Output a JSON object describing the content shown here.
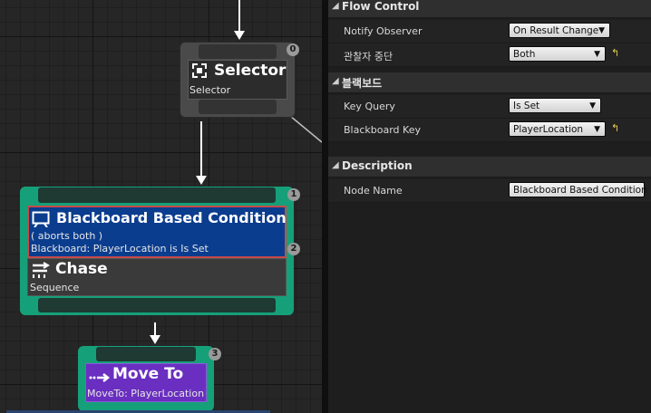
{
  "graph": {
    "selector_node": {
      "title": "Selector",
      "subtitle": "Selector",
      "index": "0",
      "icon": "selector-icon"
    },
    "chase_group": {
      "index": "1",
      "decorator": {
        "title": "Blackboard Based Condition",
        "line1": "( aborts both )",
        "line2": "Blackboard: PlayerLocation is Is Set",
        "index": "2",
        "icon": "board-icon",
        "color": "#0b3d8e"
      },
      "composite": {
        "title": "Chase",
        "subtitle": "Sequence",
        "icon": "sequence-icon"
      },
      "outline_color": "#16a07a"
    },
    "move_to_node": {
      "title": "Move To",
      "subtitle": "MoveTo: PlayerLocation",
      "index": "3",
      "icon": "move-to-icon",
      "color": "#6a2fc0"
    }
  },
  "details": {
    "sections": [
      {
        "name": "Flow Control",
        "rows": [
          {
            "label": "Notify Observer",
            "value": "On Result Change"
          },
          {
            "label": "관찰자 중단",
            "value": "Both",
            "reset": "↰"
          }
        ]
      },
      {
        "name": "블랙보드",
        "rows": [
          {
            "label": "Key Query",
            "value": "Is Set"
          },
          {
            "label": "Blackboard Key",
            "value": "PlayerLocation",
            "reset": "↰"
          }
        ]
      },
      {
        "name": "Description",
        "rows": [
          {
            "label": "Node Name",
            "value": "Blackboard Based Condition"
          }
        ]
      }
    ]
  },
  "colors": {
    "selection_green": "#16a07a",
    "decorator_blue": "#0b3d8e",
    "task_purple": "#6a2fc0",
    "reset_yellow": "#e6d24a"
  }
}
